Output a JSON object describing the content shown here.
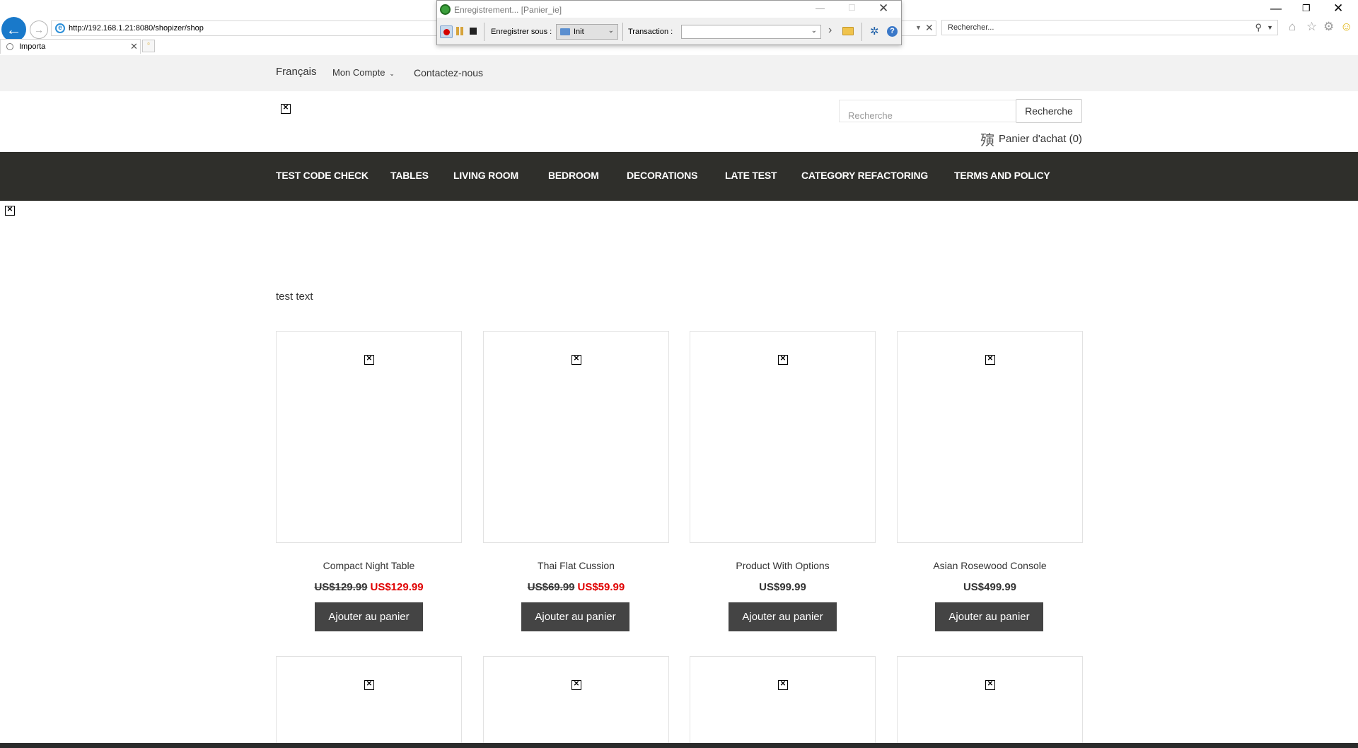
{
  "browser": {
    "url": "http://192.168.1.21:8080/shopizer/shop",
    "search_placeholder": "Rechercher...",
    "tab_title": "Importa"
  },
  "recorder": {
    "title": "Enregistrement... [Panier_ie]",
    "save_as_label": "Enregistrer sous :",
    "save_as_value": "Init",
    "transaction_label": "Transaction :",
    "transaction_value": ""
  },
  "site": {
    "topbar": {
      "language": "Français",
      "account": "Mon Compte",
      "contact": "Contactez-nous"
    },
    "search": {
      "placeholder": "Recherche",
      "button": "Recherche"
    },
    "cart": {
      "icon_glyph": "殥",
      "label": "Panier d'achat (0)"
    },
    "nav": [
      "TEST CODE CHECK",
      "TABLES",
      "LIVING ROOM",
      "BEDROOM",
      "DECORATIONS",
      "LATE TEST",
      "CATEGORY REFACTORING",
      "TERMS AND POLICY"
    ],
    "intro_text": "test text",
    "products": [
      {
        "name": "Compact Night Table",
        "old_price": "US$129.99",
        "price": "US$129.99",
        "on_sale": true,
        "button": "Ajouter au panier"
      },
      {
        "name": "Thai Flat Cussion",
        "old_price": "US$69.99",
        "price": "US$59.99",
        "on_sale": true,
        "button": "Ajouter au panier"
      },
      {
        "name": "Product With Options",
        "old_price": "",
        "price": "US$99.99",
        "on_sale": false,
        "button": "Ajouter au panier"
      },
      {
        "name": "Asian Rosewood Console",
        "old_price": "",
        "price": "US$499.99",
        "on_sale": false,
        "button": "Ajouter au panier"
      }
    ]
  },
  "colors": {
    "nav_background": "#2f2f2b",
    "sale_price": "#e00000",
    "button_background": "#444444",
    "browser_accent": "#1979ca"
  }
}
